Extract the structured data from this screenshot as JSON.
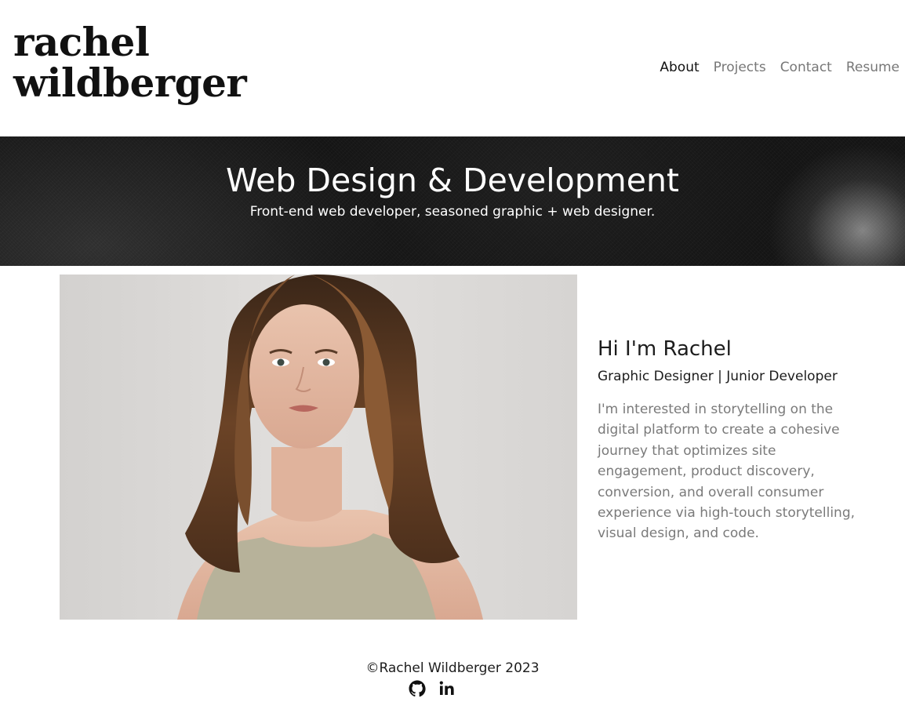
{
  "header": {
    "logo_line1": "rachel",
    "logo_line2": "wildberger",
    "nav": [
      {
        "label": "About",
        "active": true
      },
      {
        "label": "Projects",
        "active": false
      },
      {
        "label": "Contact",
        "active": false
      },
      {
        "label": "Resume",
        "active": false
      }
    ]
  },
  "hero": {
    "title": "Web Design & Development",
    "subtitle": "Front-end web developer, seasoned graphic + web designer."
  },
  "about": {
    "heading": "Hi I'm Rachel",
    "role": "Graphic Designer | Junior Developer",
    "bio": "I'm interested in storytelling on the digital platform to create a cohesive journey that optimizes site engagement, product discovery, conversion, and overall consumer experience via high-touch storytelling, visual design, and code."
  },
  "footer": {
    "copyright": "©Rachel Wildberger 2023",
    "social": [
      {
        "icon": "github-icon"
      },
      {
        "icon": "linkedin-icon"
      }
    ]
  },
  "colors": {
    "text": "#1c1c1c",
    "muted": "#7a7a7a",
    "hero_bg": "#141414",
    "nav_inactive": "#777777"
  }
}
